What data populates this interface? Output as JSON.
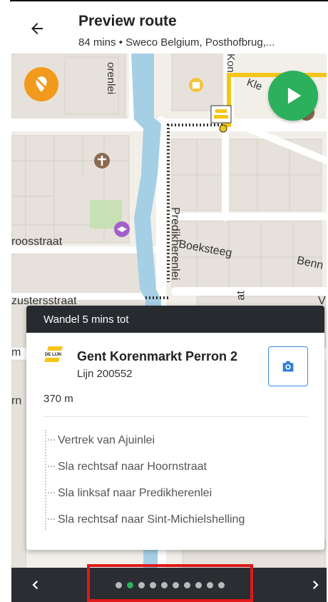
{
  "header": {
    "title": "Preview route",
    "subtitle": "84 mins • Sweco Belgium, Posthofbrug,..."
  },
  "map": {
    "labels": {
      "korenlei": "orenlei",
      "kon": "Kon",
      "kl": "Kle",
      "roosstraat": "roosstraat",
      "predikherenlei": "Predikherenlei",
      "boeksteeg": "Boeksteeg",
      "benn": "Benn",
      "zustersstraat": "zustersstraat",
      "at": "at",
      "v": "V",
      "m": "m",
      "rn": "rn"
    },
    "colors": {
      "water": "#a5cfe5",
      "route_yellow": "#f5c518",
      "road": "#ffffff",
      "park": "#c8e0b4",
      "building": "#e5e1da"
    }
  },
  "card": {
    "walk_header": "Wandel 5 mins tot",
    "stop_name": "Gent Korenmarkt Perron 2",
    "line": "Lijn 200552",
    "distance": "370 m",
    "steps": [
      "Vertrek van Ajuinlei",
      "Sla rechtsaf naar Hoornstraat",
      "Sla linksaf naar Predikherenlei",
      "Sla rechtsaf naar Sint-Michielshelling"
    ],
    "logo_text": "DE LIJN"
  },
  "pager": {
    "total": 10,
    "active_index": 1,
    "accent": "#2bb05b"
  }
}
